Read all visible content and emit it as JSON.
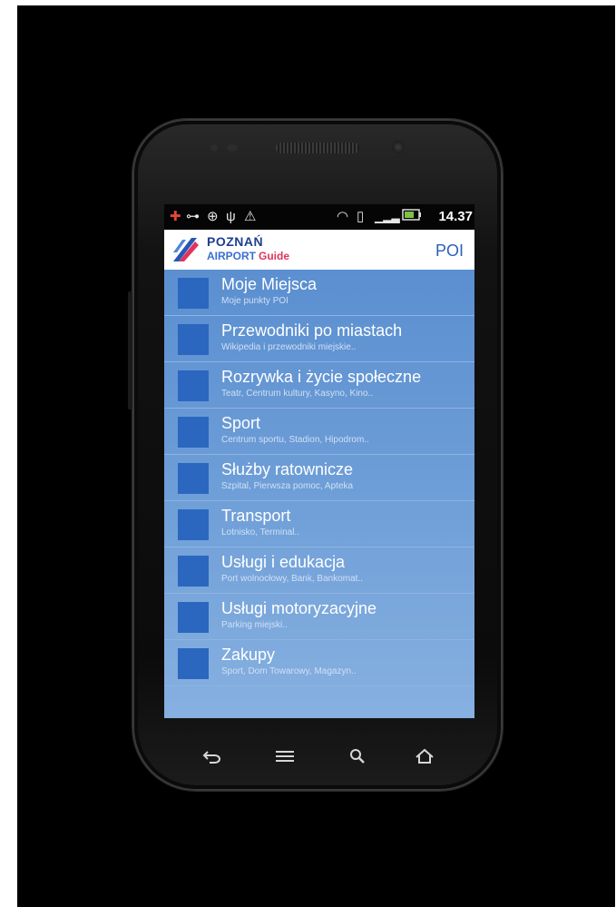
{
  "status_bar": {
    "icons": [
      "app-notification-icon",
      "voicemail-icon",
      "download-icon",
      "usb-icon",
      "warning-icon",
      "wifi-icon",
      "sim-icon",
      "signal-icon",
      "battery-icon"
    ],
    "time": "14.37"
  },
  "app_bar": {
    "logo_line1": "POZNAŃ",
    "logo_line2": "AIRPORT",
    "logo_guide": "Guide",
    "title": "POI"
  },
  "categories": [
    {
      "title": "Moje Miejsca",
      "subtitle": "Moje punkty POI"
    },
    {
      "title": "Przewodniki po miastach",
      "subtitle": "Wikipedia i przewodniki miejskie.."
    },
    {
      "title": "Rozrywka i życie społeczne",
      "subtitle": "Teatr, Centrum kultury, Kasyno, Kino.."
    },
    {
      "title": "Sport",
      "subtitle": "Centrum sportu, Stadion, Hipodrom.."
    },
    {
      "title": "Służby ratownicze",
      "subtitle": "Szpital, Pierwsza pomoc, Apteka"
    },
    {
      "title": "Transport",
      "subtitle": "Lotnisko, Terminal.."
    },
    {
      "title": "Usługi i edukacja",
      "subtitle": "Port wolnocłowy, Bank, Bankomat.."
    },
    {
      "title": "Usługi motoryzacyjne",
      "subtitle": "Parking miejski.."
    },
    {
      "title": "Zakupy",
      "subtitle": "Sport, Dom Towarowy, Magazyn.."
    }
  ],
  "nav_buttons": [
    "back-icon",
    "menu-icon",
    "search-icon",
    "home-icon"
  ],
  "colors": {
    "list_top": "#5b8fd0",
    "list_bottom": "#86b0e0",
    "category_square": "#2b67bf",
    "title_blue": "#2d5fb8",
    "guide_pink": "#e0345f"
  }
}
